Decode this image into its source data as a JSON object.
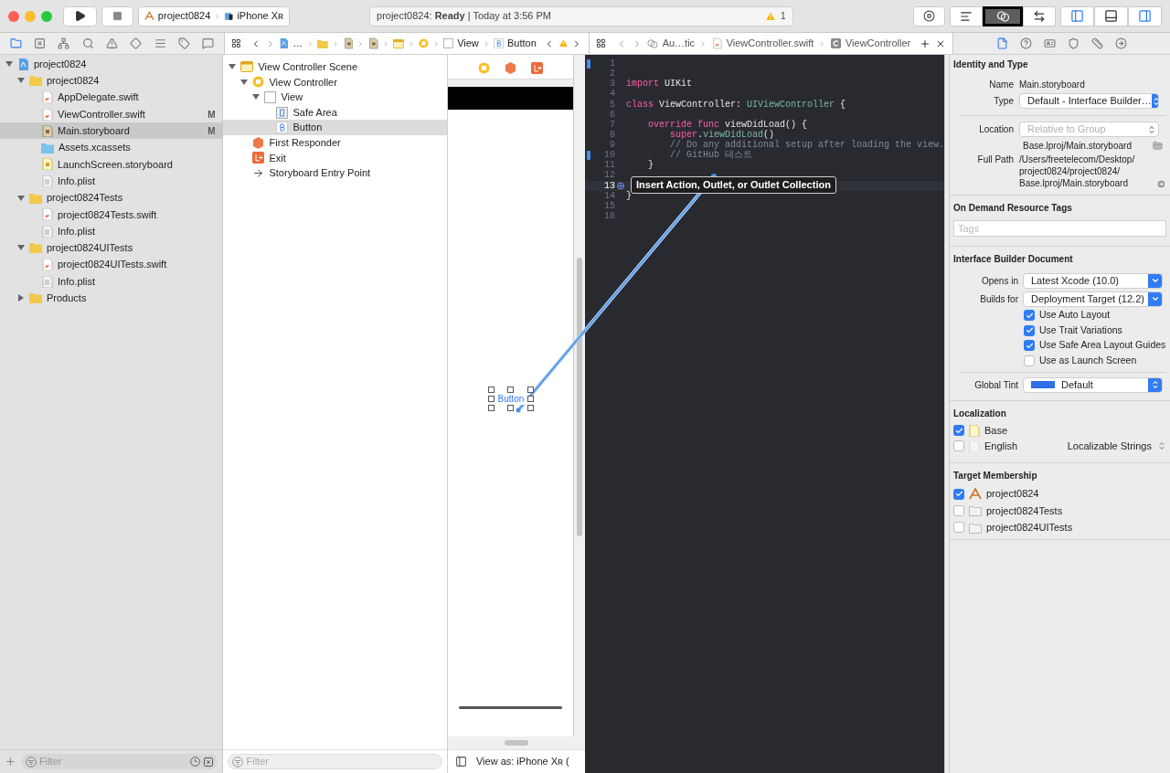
{
  "toolbar": {
    "scheme": "project0824",
    "destination": "iPhone Xʀ",
    "activity": "project0824: **Ready** | Today at 3:56 PM",
    "warnings": "1",
    "editor_modes": [
      {
        "kind": "standard",
        "selected": false
      },
      {
        "kind": "assistant",
        "selected": true
      },
      {
        "kind": "version",
        "selected": false
      }
    ],
    "panels": [
      {
        "kind": "navigator",
        "on": true
      },
      {
        "kind": "debug",
        "on": false
      },
      {
        "kind": "inspector",
        "on": true
      }
    ]
  },
  "navigator": {
    "tabs": [
      {
        "kind": "project",
        "selected": true
      },
      {
        "kind": "source",
        "selected": false
      },
      {
        "kind": "symbol",
        "selected": false
      },
      {
        "kind": "find",
        "selected": false
      },
      {
        "kind": "issue",
        "selected": false
      },
      {
        "kind": "test",
        "selected": false
      },
      {
        "kind": "debug",
        "selected": false
      },
      {
        "kind": "breakpoint",
        "selected": false
      },
      {
        "kind": "report",
        "selected": false
      }
    ],
    "tree": [
      {
        "label": "project0824",
        "kind": "project",
        "selected": false,
        "expanded": true,
        "children": [
          {
            "label": "project0824",
            "kind": "folder",
            "selected": false,
            "expanded": true,
            "children": [
              {
                "label": "AppDelegate.swift",
                "kind": "swift",
                "selected": false
              },
              {
                "label": "ViewController.swift",
                "kind": "swift",
                "selected": false,
                "badge": "M"
              },
              {
                "label": "Main.storyboard",
                "kind": "storyboard",
                "selected": true,
                "badge": "M"
              },
              {
                "label": "Assets.xcassets",
                "kind": "assets",
                "selected": false
              },
              {
                "label": "LaunchScreen.storyboard",
                "kind": "launch",
                "selected": false
              },
              {
                "label": "Info.plist",
                "kind": "plist",
                "selected": false
              }
            ]
          },
          {
            "label": "project0824Tests",
            "kind": "folder",
            "selected": false,
            "expanded": true,
            "children": [
              {
                "label": "project0824Tests.swift",
                "kind": "swift",
                "selected": false
              },
              {
                "label": "Info.plist",
                "kind": "plist",
                "selected": false
              }
            ]
          },
          {
            "label": "project0824UITests",
            "kind": "folder",
            "selected": false,
            "expanded": true,
            "children": [
              {
                "label": "project0824UITests.swift",
                "kind": "swift",
                "selected": false
              },
              {
                "label": "Info.plist",
                "kind": "plist",
                "selected": false
              }
            ]
          },
          {
            "label": "Products",
            "kind": "folder",
            "selected": false,
            "expanded": false
          }
        ]
      }
    ],
    "filter_placeholder": "Filter"
  },
  "outline": {
    "jump_bar": [
      {
        "kind": "project",
        "label": "…"
      },
      {
        "kind": "folder"
      },
      {
        "kind": "storyboard"
      },
      {
        "kind": "storyboard"
      },
      {
        "kind": "scene"
      },
      {
        "kind": "controller"
      },
      {
        "kind": "view",
        "label": "View"
      },
      {
        "kind": "button",
        "label": "Button"
      }
    ],
    "tree": [
      {
        "label": "View Controller Scene",
        "kind": "scene",
        "selected": false,
        "expanded": true,
        "children": [
          {
            "label": "View Controller",
            "kind": "controller",
            "selected": false,
            "expanded": true,
            "children": [
              {
                "label": "View",
                "kind": "view",
                "selected": false,
                "expanded": true,
                "children": [
                  {
                    "label": "Safe Area",
                    "kind": "safe-area",
                    "selected": false
                  },
                  {
                    "label": "Button",
                    "kind": "button",
                    "selected": true
                  }
                ]
              }
            ]
          },
          {
            "label": "First Responder",
            "kind": "responder",
            "selected": false
          },
          {
            "label": "Exit",
            "kind": "exit",
            "selected": false
          },
          {
            "label": "Storyboard Entry Point",
            "kind": "entry",
            "selected": false
          }
        ]
      }
    ],
    "filter_placeholder": "Filter"
  },
  "canvas": {
    "button_label": "Button",
    "view_as": "View as: iPhone Xʀ ("
  },
  "editor": {
    "jump_bar": [
      {
        "kind": "assistant",
        "label": "Au…tic"
      },
      {
        "kind": "swift",
        "label": "ViewController.swift"
      },
      {
        "kind": "class",
        "label": "ViewController"
      }
    ],
    "lines": [
      {
        "number": "1",
        "changed": true,
        "current": false
      },
      {
        "number": "2",
        "changed": false,
        "current": false
      },
      {
        "number": "3",
        "changed": false,
        "current": false,
        "tokens": [
          {
            "kind": "keyword",
            "text": "import"
          },
          {
            "kind": "plain",
            "text": " UIKit"
          }
        ]
      },
      {
        "number": "4",
        "changed": false,
        "current": false
      },
      {
        "number": "5",
        "changed": false,
        "current": false,
        "tokens": [
          {
            "kind": "keyword",
            "text": "class"
          },
          {
            "kind": "plain",
            "text": " ViewController: "
          },
          {
            "kind": "type",
            "text": "UIViewController"
          },
          {
            "kind": "plain",
            "text": " {"
          }
        ]
      },
      {
        "number": "6",
        "changed": false,
        "current": false
      },
      {
        "number": "7",
        "changed": false,
        "current": false,
        "tokens": [
          {
            "kind": "keyword",
            "text": "    override func"
          },
          {
            "kind": "plain",
            "text": " viewDidLoad() {"
          }
        ]
      },
      {
        "number": "8",
        "changed": false,
        "current": false,
        "tokens": [
          {
            "kind": "keyword",
            "text": "        super"
          },
          {
            "kind": "plain",
            "text": "."
          },
          {
            "kind": "call",
            "text": "viewDidLoad"
          },
          {
            "kind": "plain",
            "text": "()"
          }
        ]
      },
      {
        "number": "9",
        "changed": false,
        "current": false,
        "tokens": [
          {
            "kind": "comment",
            "text": "        // Do any additional setup after loading the view."
          }
        ]
      },
      {
        "number": "10",
        "changed": true,
        "current": false,
        "tokens": [
          {
            "kind": "comment",
            "text": "        // GitHub 테스트"
          }
        ]
      },
      {
        "number": "11",
        "changed": false,
        "current": false,
        "tokens": [
          {
            "kind": "plain",
            "text": "    }"
          }
        ]
      },
      {
        "number": "12",
        "changed": false,
        "current": false
      },
      {
        "number": "13",
        "changed": false,
        "current": true
      },
      {
        "number": "14",
        "changed": false,
        "current": false,
        "tokens": [
          {
            "kind": "plain",
            "text": "}"
          }
        ]
      },
      {
        "number": "15",
        "changed": false,
        "current": false
      },
      {
        "number": "16",
        "changed": false,
        "current": false
      }
    ],
    "tooltip": "Insert Action, Outlet, or Outlet Collection"
  },
  "inspector": {
    "tabs": [
      {
        "kind": "file",
        "selected": true
      },
      {
        "kind": "help",
        "selected": false
      },
      {
        "kind": "identity",
        "selected": false
      },
      {
        "kind": "attributes",
        "selected": false
      },
      {
        "kind": "size",
        "selected": false
      },
      {
        "kind": "connections",
        "selected": false
      }
    ],
    "identity": {
      "title": "Identity and Type",
      "name_label": "Name",
      "name": "Main.storyboard",
      "type_label": "Type",
      "type": "Default - Interface Builder…",
      "location_label": "Location",
      "location": "Relative to Group",
      "location_path": "Base.lproj/Main.storyboard",
      "full_path_label": "Full Path",
      "full_path_lines": [
        "/Users/freetelecom/Desktop/",
        "project0824/project0824/",
        "Base.lproj/Main.storyboard"
      ]
    },
    "resource_tags": {
      "title": "On Demand Resource Tags",
      "placeholder": "Tags"
    },
    "ib_document": {
      "title": "Interface Builder Document",
      "opens_in_label": "Opens in",
      "opens_in": "Latest Xcode (10.0)",
      "builds_for_label": "Builds for",
      "builds_for": "Deployment Target (12.2)",
      "options": [
        {
          "label": "Use Auto Layout",
          "checked": true
        },
        {
          "label": "Use Trait Variations",
          "checked": true
        },
        {
          "label": "Use Safe Area Layout Guides",
          "checked": true
        },
        {
          "label": "Use as Launch Screen",
          "checked": false
        }
      ],
      "tint_label": "Global Tint",
      "tint": "Default"
    },
    "localization": {
      "title": "Localization",
      "items": [
        {
          "label": "Base",
          "checked": true
        },
        {
          "label": "English",
          "checked": false,
          "type": "Localizable Strings"
        }
      ]
    },
    "target_membership": {
      "title": "Target Membership",
      "items": [
        {
          "label": "project0824",
          "checked": true,
          "kind": "app"
        },
        {
          "label": "project0824Tests",
          "checked": false,
          "kind": "bundle"
        },
        {
          "label": "project0824UITests",
          "checked": false,
          "kind": "bundle"
        }
      ]
    }
  }
}
